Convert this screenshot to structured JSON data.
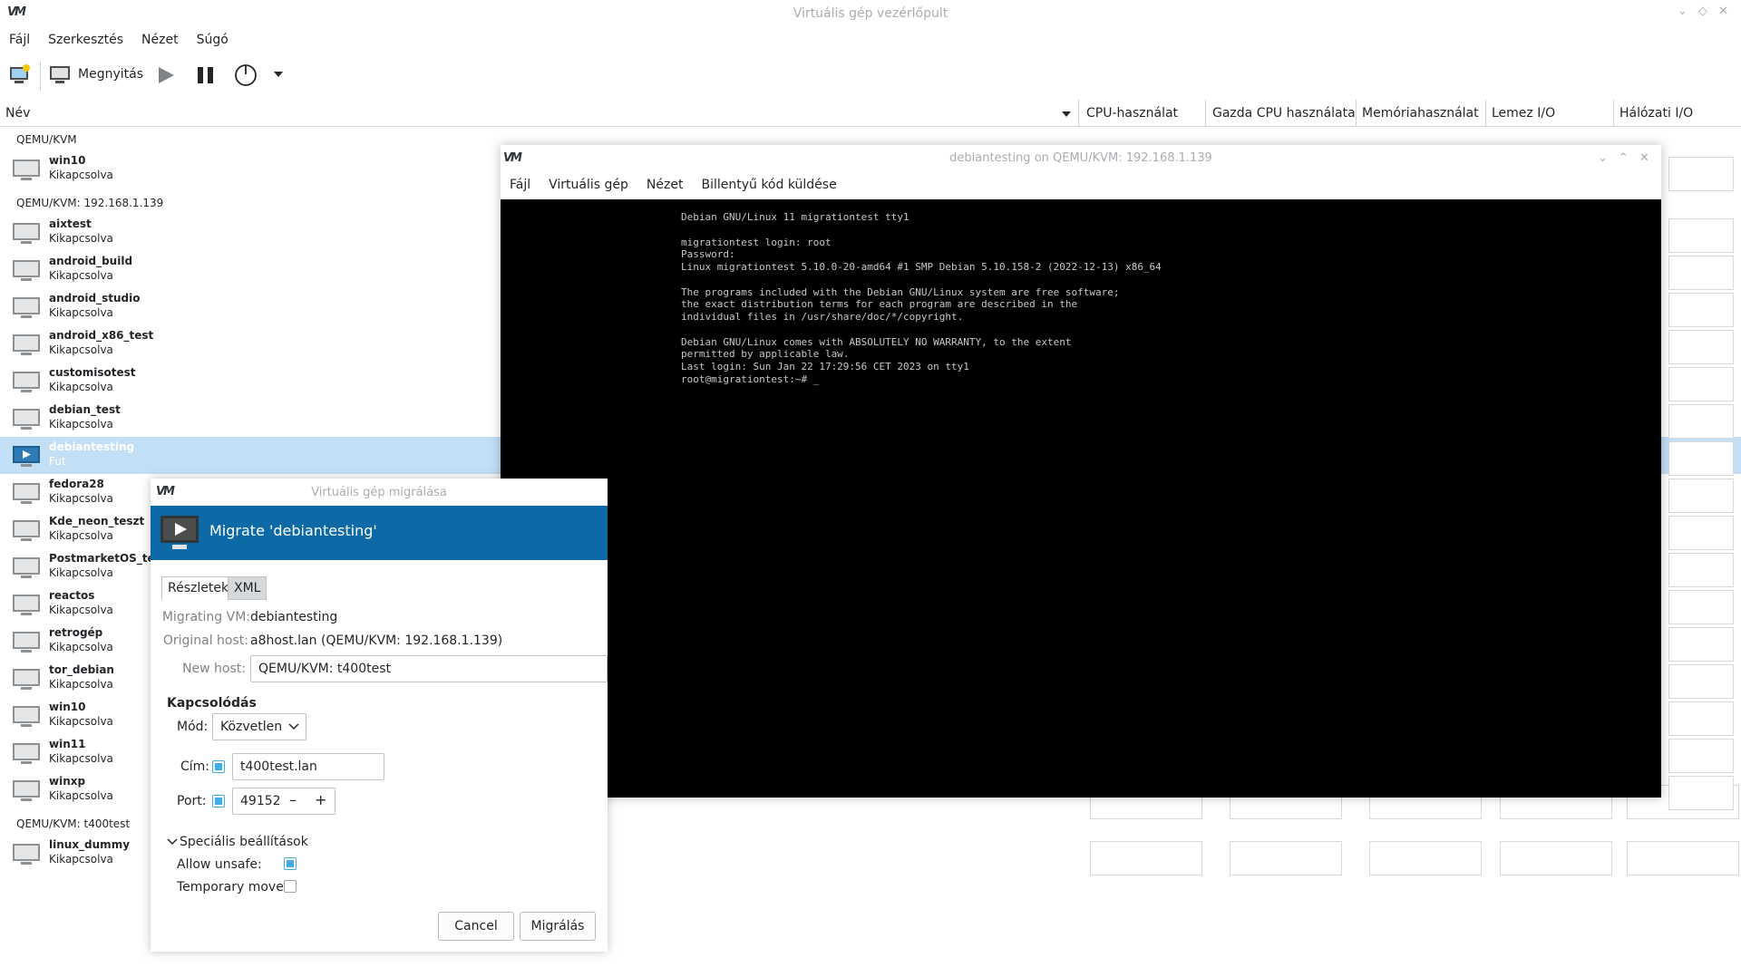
{
  "main_window": {
    "title": "Virtuális gép vezérlőpult",
    "menu": [
      "Fájl",
      "Szerkesztés",
      "Nézet",
      "Súgó"
    ],
    "toolbar": {
      "open_label": "Megnyitás"
    },
    "columns": [
      "Név",
      "CPU-használat",
      "Gazda CPU használata",
      "Memóriahasználat",
      "Lemez I/O",
      "Hálózati I/O"
    ]
  },
  "connections": [
    {
      "label": "QEMU/KVM"
    },
    {
      "label": "QEMU/KVM: 192.168.1.139"
    },
    {
      "label": "QEMU/KVM: t400test"
    }
  ],
  "vms": [
    {
      "name": "win10",
      "status": "Kikapcsolva"
    },
    {
      "name": "aixtest",
      "status": "Kikapcsolva"
    },
    {
      "name": "android_build",
      "status": "Kikapcsolva"
    },
    {
      "name": "android_studio",
      "status": "Kikapcsolva"
    },
    {
      "name": "android_x86_test",
      "status": "Kikapcsolva"
    },
    {
      "name": "customisotest",
      "status": "Kikapcsolva"
    },
    {
      "name": "debian_test",
      "status": "Kikapcsolva"
    },
    {
      "name": "debiantesting",
      "status": "Fut"
    },
    {
      "name": "fedora28",
      "status": "Kikapcsolva"
    },
    {
      "name": "Kde_neon_teszt",
      "status": "Kikapcsolva"
    },
    {
      "name": "PostmarketOS_teszt",
      "status": "Kikapcsolva"
    },
    {
      "name": "reactos",
      "status": "Kikapcsolva"
    },
    {
      "name": "retrogép",
      "status": "Kikapcsolva"
    },
    {
      "name": "tor_debian",
      "status": "Kikapcsolva"
    },
    {
      "name": "win10",
      "status": "Kikapcsolva"
    },
    {
      "name": "win11",
      "status": "Kikapcsolva"
    },
    {
      "name": "winxp",
      "status": "Kikapcsolva"
    },
    {
      "name": "linux_dummy",
      "status": "Kikapcsolva"
    }
  ],
  "console_window": {
    "title": "debiantesting on QEMU/KVM: 192.168.1.139",
    "menu": [
      "Fájl",
      "Virtuális gép",
      "Nézet",
      "Billentyű kód küldése"
    ],
    "lines": [
      "Debian GNU/Linux 11 migrationtest tty1",
      "",
      "migrationtest login: root",
      "Password:",
      "Linux migrationtest 5.10.0-20-amd64 #1 SMP Debian 5.10.158-2 (2022-12-13) x86_64",
      "",
      "The programs included with the Debian GNU/Linux system are free software;",
      "the exact distribution terms for each program are described in the",
      "individual files in /usr/share/doc/*/copyright.",
      "",
      "Debian GNU/Linux comes with ABSOLUTELY NO WARRANTY, to the extent",
      "permitted by applicable law.",
      "Last login: Sun Jan 22 17:29:56 CET 2023 on tty1",
      "root@migrationtest:~# _"
    ]
  },
  "migrate_dialog": {
    "window_title": "Virtuális gép migrálása",
    "header": "Migrate 'debiantesting'",
    "tabs": [
      "Részletek",
      "XML"
    ],
    "migrating_vm_label": "Migrating VM:",
    "migrating_vm": "debiantesting",
    "original_host_label": "Original host:",
    "original_host": "a8host.lan (QEMU/KVM: 192.168.1.139)",
    "new_host_label": "New host:",
    "new_host": "QEMU/KVM: t400test",
    "connection_section": "Kapcsolódás",
    "mode_label": "Mód:",
    "mode": "Közvetlen",
    "address_label": "Cím:",
    "address": "t400test.lan",
    "port_label": "Port:",
    "port": "49152",
    "advanced_label": "Speciális beállítások",
    "allow_unsafe_label": "Allow unsafe:",
    "allow_unsafe": true,
    "temporary_move_label": "Temporary move:",
    "temporary_move": false,
    "cancel_label": "Cancel",
    "migrate_label": "Migrálás"
  },
  "colors": {
    "accent": "#3daee9",
    "header_blue": "#0e6aa6",
    "selection": "#c3dff6"
  }
}
